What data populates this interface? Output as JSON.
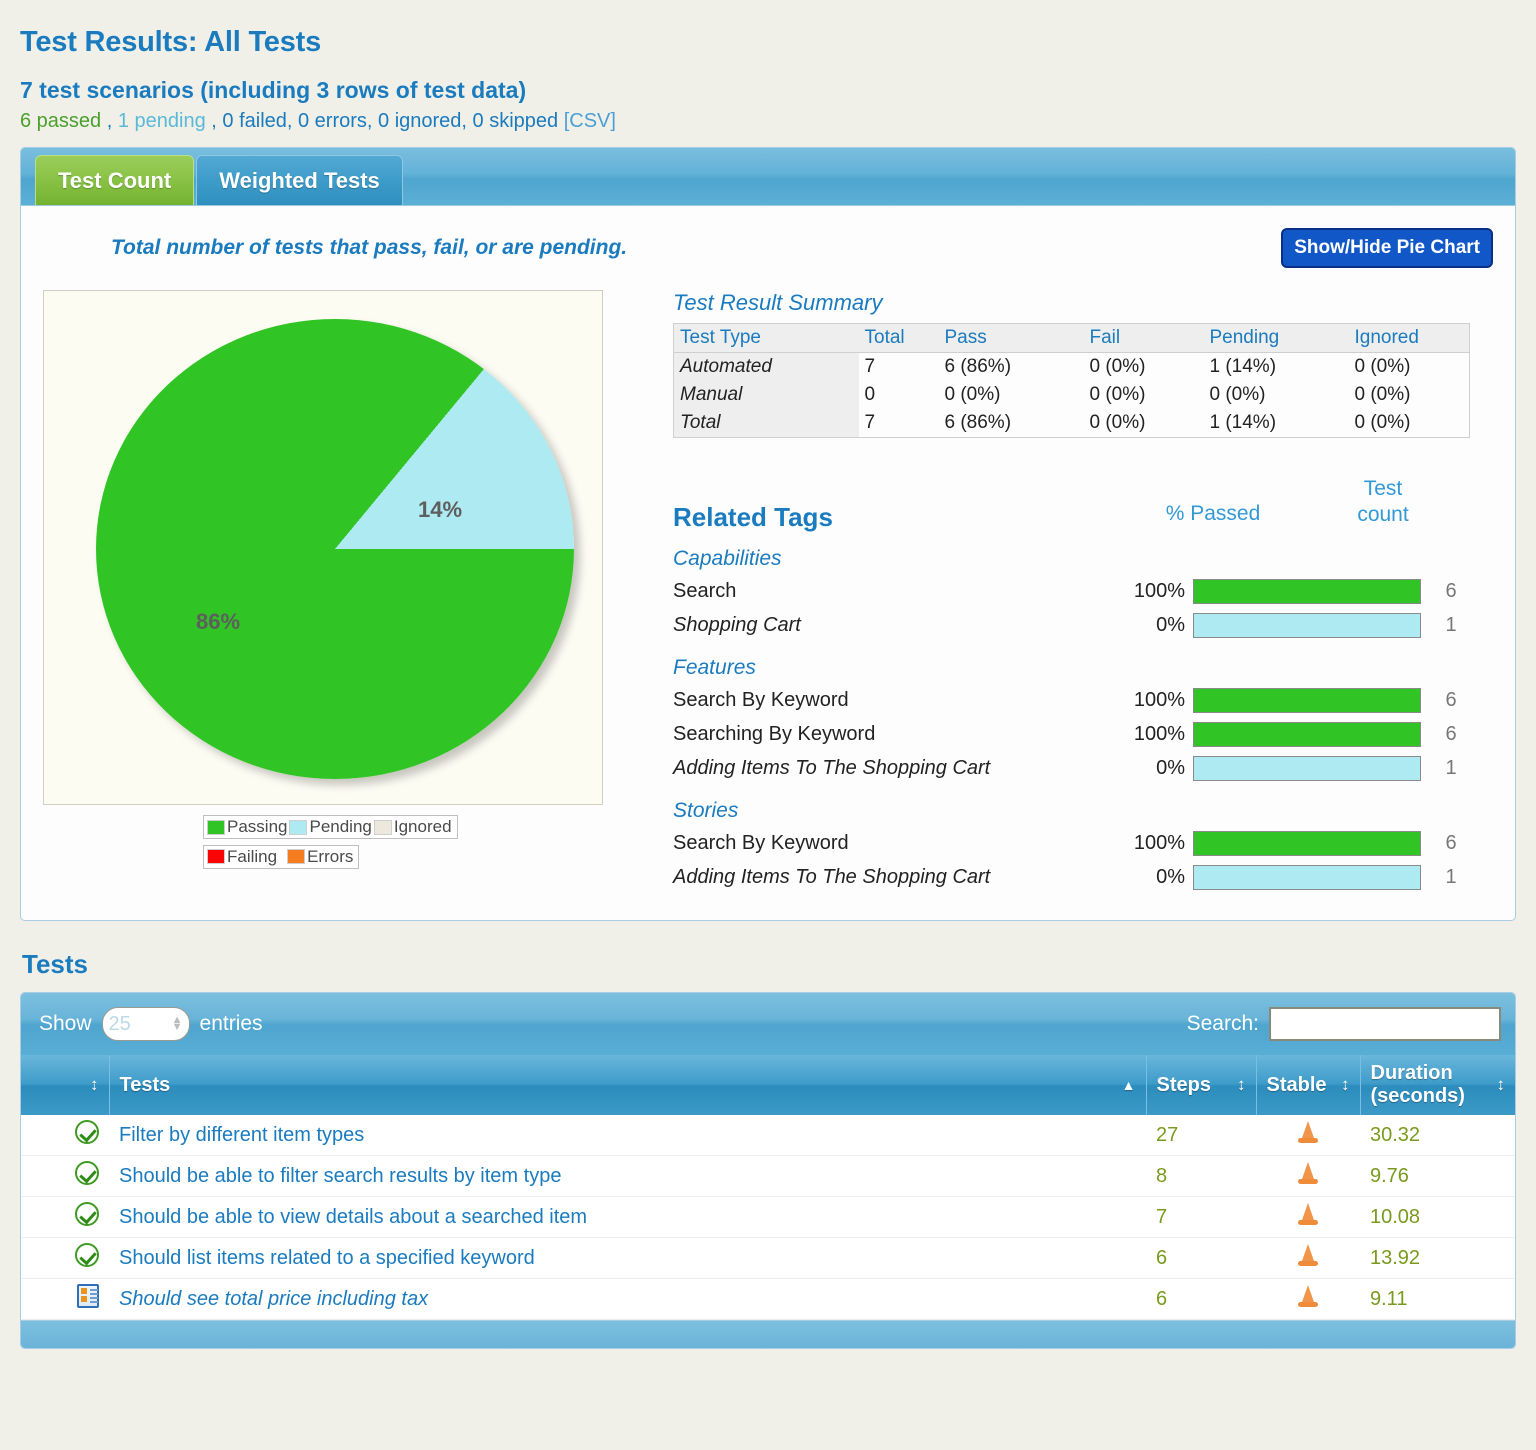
{
  "header": {
    "title": "Test Results: All Tests",
    "scenario_line": "7 test scenarios (including 3 rows of test data)",
    "counts": {
      "passed": "6 passed",
      "sep1": " , ",
      "pending": "1 pending",
      "sep2": " , ",
      "rest": "0 failed, 0 errors, 0 ignored, 0 skipped",
      "csv": "[CSV]"
    }
  },
  "tabs": [
    {
      "label": "Test Count",
      "active": true
    },
    {
      "label": "Weighted Tests",
      "active": false
    }
  ],
  "panel": {
    "caption": "Total number of tests that pass, fail, or are pending.",
    "pie_toggle_label": "Show/Hide Pie Chart"
  },
  "chart_data": {
    "type": "pie",
    "title": "Total number of tests that pass, fail, or are pending.",
    "categories": [
      "Passing",
      "Pending",
      "Ignored",
      "Failing",
      "Errors"
    ],
    "values": [
      86,
      14,
      0,
      0,
      0
    ],
    "value_labels": [
      "86%",
      "14%"
    ],
    "colors": [
      "#30c525",
      "#aeeaf2",
      "#ece8dc",
      "#fa0505",
      "#f57c1f"
    ],
    "legend_position": "bottom",
    "legend": [
      {
        "label": "Passing",
        "color": "#30c525"
      },
      {
        "label": "Pending",
        "color": "#aeeaf2"
      },
      {
        "label": "Ignored",
        "color": "#ece8dc"
      },
      {
        "label": "Failing",
        "color": "#fa0505"
      },
      {
        "label": "Errors",
        "color": "#f57c1f"
      }
    ]
  },
  "summary": {
    "title": "Test Result Summary",
    "columns": [
      "Test Type",
      "Total",
      "Pass",
      "Fail",
      "Pending",
      "Ignored"
    ],
    "rows": [
      {
        "type": "Automated",
        "total": "7",
        "pass": "6 (86%)",
        "fail": "0 (0%)",
        "pending": "1 (14%)",
        "ignored": "0 (0%)"
      },
      {
        "type": "Manual",
        "total": "0",
        "pass": "0 (0%)",
        "fail": "0 (0%)",
        "pending": "0 (0%)",
        "ignored": "0 (0%)"
      },
      {
        "type": "Total",
        "total": "7",
        "pass": "6 (86%)",
        "fail": "0 (0%)",
        "pending": "1 (14%)",
        "ignored": "0 (0%)"
      }
    ]
  },
  "related_tags": {
    "title": "Related Tags",
    "pct_header": "% Passed",
    "count_header_line1": "Test",
    "count_header_line2": "count",
    "groups": [
      {
        "title": "Capabilities",
        "rows": [
          {
            "name": "Search",
            "italic": false,
            "pct": "100%",
            "bar_pct": 100,
            "count": "6"
          },
          {
            "name": "Shopping Cart",
            "italic": true,
            "pct": "0%",
            "bar_pct": 0,
            "count": "1"
          }
        ]
      },
      {
        "title": "Features",
        "rows": [
          {
            "name": "Search By Keyword",
            "italic": false,
            "pct": "100%",
            "bar_pct": 100,
            "count": "6"
          },
          {
            "name": "Searching By Keyword",
            "italic": false,
            "pct": "100%",
            "bar_pct": 100,
            "count": "6"
          },
          {
            "name": "Adding Items To The Shopping Cart",
            "italic": true,
            "pct": "0%",
            "bar_pct": 0,
            "count": "1"
          }
        ]
      },
      {
        "title": "Stories",
        "rows": [
          {
            "name": "Search By Keyword",
            "italic": false,
            "pct": "100%",
            "bar_pct": 100,
            "count": "6"
          },
          {
            "name": "Adding Items To The Shopping Cart",
            "italic": true,
            "pct": "0%",
            "bar_pct": 0,
            "count": "1"
          }
        ]
      }
    ]
  },
  "tests_section": {
    "title": "Tests",
    "show_label": "Show",
    "entries_value": "25",
    "entries_label": "entries",
    "search_label": "Search:",
    "search_value": "",
    "columns": {
      "status": "",
      "tests": "Tests",
      "steps": "Steps",
      "stable": "Stable",
      "duration_line1": "Duration",
      "duration_line2": "(seconds)"
    },
    "rows": [
      {
        "status": "pass",
        "name": "Filter by different item types",
        "steps": "27",
        "stable": "cone",
        "duration": "30.32"
      },
      {
        "status": "pass",
        "name": "Should be able to filter search results by item type",
        "steps": "8",
        "stable": "cone",
        "duration": "9.76"
      },
      {
        "status": "pass",
        "name": "Should be able to view details about a searched item",
        "steps": "7",
        "stable": "cone",
        "duration": "10.08"
      },
      {
        "status": "pass",
        "name": "Should list items related to a specified keyword",
        "steps": "6",
        "stable": "cone",
        "duration": "13.92"
      },
      {
        "status": "pending",
        "name": "Should see total price including tax",
        "steps": "6",
        "stable": "cone",
        "duration": "9.11"
      }
    ]
  },
  "colors": {
    "brand_blue": "#1a7bbf",
    "pass_green": "#30c525",
    "pending_cyan": "#aeeaf2",
    "fail_red": "#fa0505",
    "error_orange": "#f57c1f",
    "metric_olive": "#7a9a1e"
  }
}
